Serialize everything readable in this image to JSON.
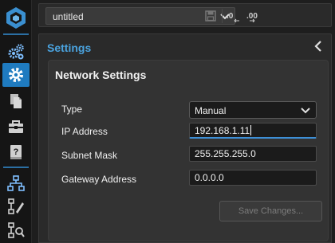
{
  "rail": {
    "items": [
      {
        "name": "app-logo-icon"
      },
      {
        "name": "device-settings-icon"
      },
      {
        "name": "settings-gear-icon",
        "active": true
      },
      {
        "name": "documents-icon"
      },
      {
        "name": "tools-icon"
      },
      {
        "name": "help-book-icon"
      },
      {
        "name": "network-tree-icon"
      },
      {
        "name": "edit-hierarchy-icon"
      },
      {
        "name": "search-hierarchy-icon"
      }
    ],
    "accent": "#1f7bc0"
  },
  "toolbar": {
    "project_name": "untitled",
    "icons": [
      "chevron-down-icon",
      "save-icon",
      "decimal-decrease-icon",
      "decimal-increase-icon"
    ]
  },
  "panel": {
    "title": "Settings",
    "title_color": "#4aa3df",
    "card": {
      "title": "Network Settings",
      "fields": {
        "type": {
          "label": "Type",
          "value": "Manual"
        },
        "ip_address": {
          "label": "IP Address",
          "value": "192.168.1.11"
        },
        "subnet_mask": {
          "label": "Subnet Mask",
          "value": "255.255.255.0"
        },
        "gateway": {
          "label": "Gateway Address",
          "value": "0.0.0.0"
        }
      },
      "save_label": "Save Changes..."
    }
  }
}
